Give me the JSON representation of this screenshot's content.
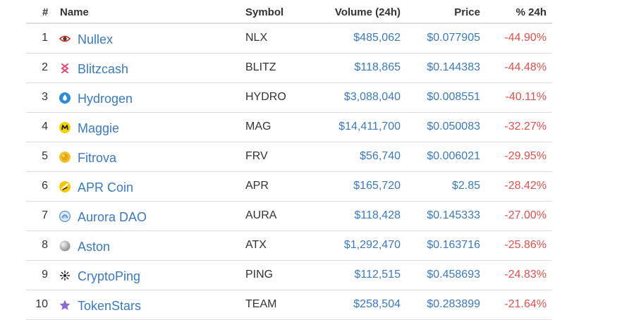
{
  "headers": {
    "rank": "#",
    "name": "Name",
    "symbol": "Symbol",
    "volume": "Volume (24h)",
    "price": "Price",
    "change": "% 24h"
  },
  "colors": {
    "link": "#3d7ab8",
    "negative": "#d9534f",
    "border": "#dddddd"
  },
  "rows": [
    {
      "rank": "1",
      "name": "Nullex",
      "symbol": "NLX",
      "volume": "$485,062",
      "price": "$0.077905",
      "change": "-44.90%",
      "icon": "nullex-eye-icon"
    },
    {
      "rank": "2",
      "name": "Blitzcash",
      "symbol": "BLITZ",
      "volume": "$118,865",
      "price": "$0.144383",
      "change": "-44.48%",
      "icon": "blitzcash-icon"
    },
    {
      "rank": "3",
      "name": "Hydrogen",
      "symbol": "HYDRO",
      "volume": "$3,088,040",
      "price": "$0.008551",
      "change": "-40.11%",
      "icon": "hydrogen-drop-icon"
    },
    {
      "rank": "4",
      "name": "Maggie",
      "symbol": "MAG",
      "volume": "$14,411,700",
      "price": "$0.050083",
      "change": "-32.27%",
      "icon": "maggie-coin-icon"
    },
    {
      "rank": "5",
      "name": "Fitrova",
      "symbol": "FRV",
      "volume": "$56,740",
      "price": "$0.006021",
      "change": "-29.95%",
      "icon": "fitrova-coin-icon"
    },
    {
      "rank": "6",
      "name": "APR Coin",
      "symbol": "APR",
      "volume": "$165,720",
      "price": "$2.85",
      "change": "-28.42%",
      "icon": "apr-coin-icon"
    },
    {
      "rank": "7",
      "name": "Aurora DAO",
      "symbol": "AURA",
      "volume": "$118,428",
      "price": "$0.145333",
      "change": "-27.00%",
      "icon": "aurora-dao-icon"
    },
    {
      "rank": "8",
      "name": "Aston",
      "symbol": "ATX",
      "volume": "$1,292,470",
      "price": "$0.163716",
      "change": "-25.86%",
      "icon": "aston-sphere-icon"
    },
    {
      "rank": "9",
      "name": "CryptoPing",
      "symbol": "PING",
      "volume": "$112,515",
      "price": "$0.458693",
      "change": "-24.83%",
      "icon": "cryptoping-icon"
    },
    {
      "rank": "10",
      "name": "TokenStars",
      "symbol": "TEAM",
      "volume": "$258,504",
      "price": "$0.283899",
      "change": "-21.64%",
      "icon": "tokenstars-star-icon"
    }
  ]
}
